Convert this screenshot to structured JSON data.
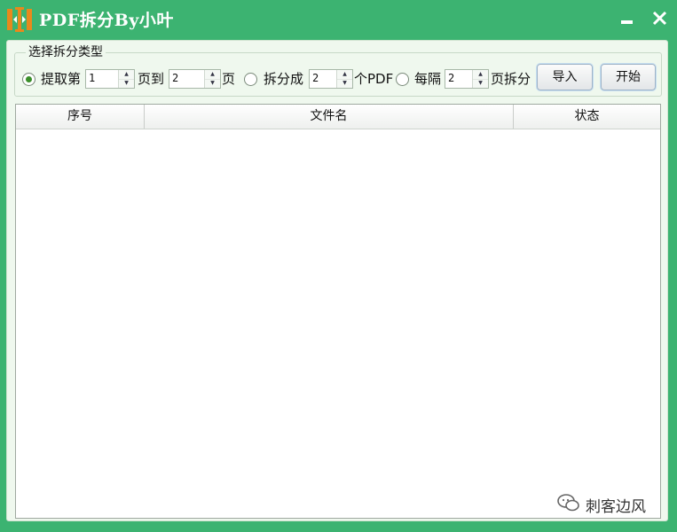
{
  "window": {
    "title": "PDF拆分By小叶",
    "minimize_icon": "minimize-icon",
    "close_icon": "close-icon",
    "app_icon": "split-pages-icon",
    "colors": {
      "titlebar": "#3cb371",
      "client": "#eff8ee"
    }
  },
  "split_group": {
    "title": "选择拆分类型",
    "options": {
      "extract": {
        "selected": true,
        "label_prefix": "提取第",
        "from_value": "1",
        "label_mid": "页到",
        "to_value": "2",
        "label_suffix": "页"
      },
      "split_into": {
        "selected": false,
        "label_prefix": "拆分成",
        "count_value": "2",
        "label_suffix": "个PDF"
      },
      "every": {
        "selected": false,
        "label_prefix": "每隔",
        "pages_value": "2",
        "label_suffix": "页拆分"
      }
    }
  },
  "buttons": {
    "import": "导入",
    "start": "开始"
  },
  "file_list": {
    "columns": [
      "序号",
      "文件名",
      "状态"
    ],
    "rows": []
  },
  "watermark": {
    "text": "刺客边风",
    "icon": "wechat-icon"
  }
}
